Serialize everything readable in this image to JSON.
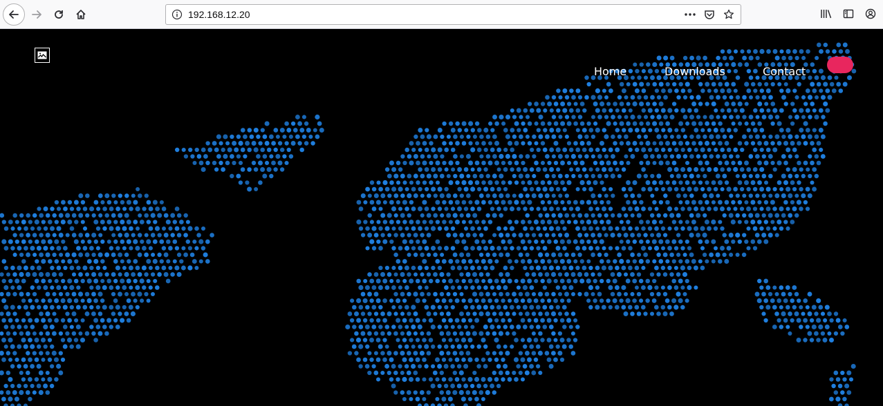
{
  "browser": {
    "url": "192.168.12.20"
  },
  "nav": {
    "items": [
      {
        "label": "Home"
      },
      {
        "label": "Downloads"
      },
      {
        "label": "Contact"
      }
    ]
  },
  "colors": {
    "dots": "#1f7fe0",
    "background": "#000000",
    "cta": "#e8265e",
    "nav_text": "#ffffff"
  },
  "icons": {
    "back": "arrow-left-icon",
    "forward": "arrow-right-icon",
    "reload": "reload-icon",
    "home": "home-icon",
    "site_info": "info-icon",
    "page_actions": "ellipsis-icon",
    "pocket": "pocket-icon",
    "bookmark": "star-icon",
    "library": "library-icon",
    "sidebar": "sidebar-icon",
    "account": "account-icon",
    "logo": "site-logo-icon"
  }
}
